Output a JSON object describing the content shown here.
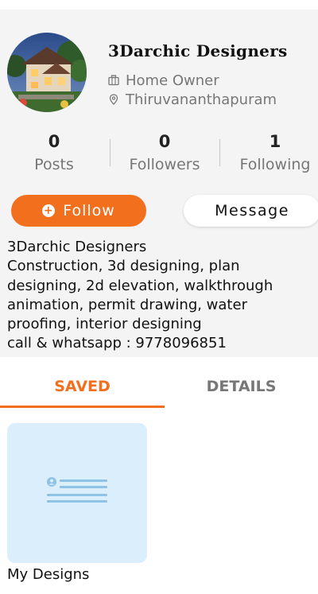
{
  "profile": {
    "name": "3Darchic Designers",
    "role": "Home Owner",
    "location": "Thiruvananthapuram"
  },
  "stats": [
    {
      "value": "0",
      "label": "Posts"
    },
    {
      "value": "0",
      "label": "Followers"
    },
    {
      "value": "1",
      "label": "Following"
    }
  ],
  "actions": {
    "follow_label": "Follow",
    "message_label": "Message"
  },
  "bio": {
    "lines": [
      "3Darchic Designers",
      "Construction, 3d designing, plan",
      "designing, 2d elevation, walkthrough",
      "animation, permit drawing, water",
      "proofing, interior designing",
      "call & whatsapp : 9778096851"
    ]
  },
  "tabs": {
    "saved": "SAVED",
    "details": "DETAILS",
    "active": "saved"
  },
  "collections": [
    {
      "label": "My Designs"
    }
  ],
  "colors": {
    "accent": "#f26f1e",
    "card_bg": "#dbeefb",
    "muted_text": "#777777",
    "icon_blue": "#8fc3e6"
  },
  "icons": {
    "role": "briefcase-icon",
    "location": "location-pin-icon",
    "follow": "plus-circle-icon",
    "collection": "profile-card-icon"
  }
}
